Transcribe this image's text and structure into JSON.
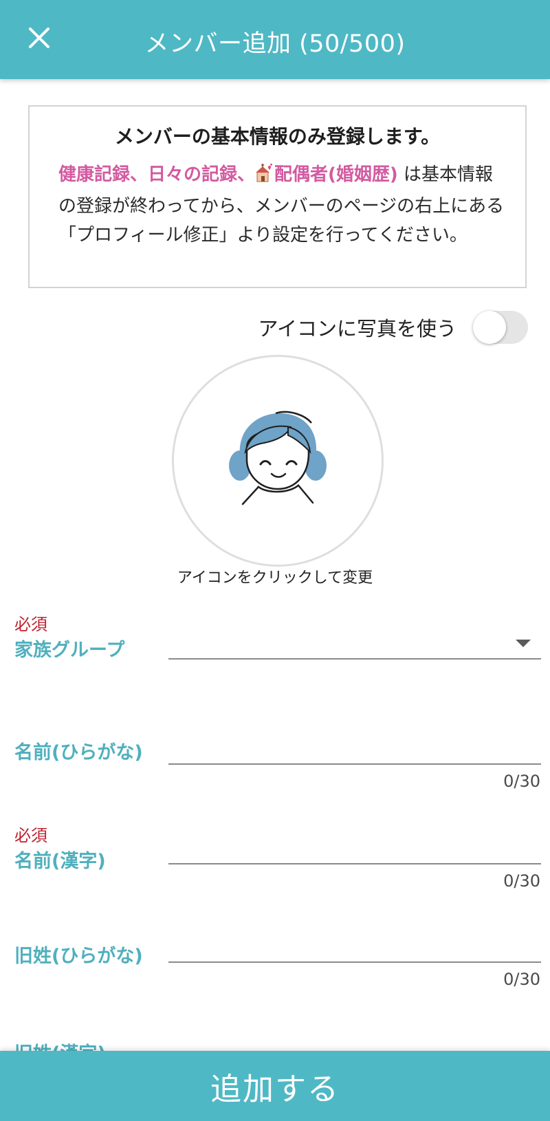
{
  "header": {
    "title": "メンバー追加 (50/500)",
    "close_icon": "close-icon"
  },
  "notice": {
    "heading": "メンバーの基本情報のみ登録します。",
    "highlight_1": "健康記録、日々の記録、",
    "highlight_2": "配偶者(婚姻歴)",
    "body": " は基本情報の登録が終わってから、メンバーのページの右上にある「プロフィール修正」より設定を行ってください。"
  },
  "photo_toggle": {
    "label": "アイコンに写真を使う",
    "on": false
  },
  "avatar": {
    "icon": "girl-avatar-icon",
    "hint": "アイコンをクリックして変更"
  },
  "form": {
    "family_group": {
      "required": "必須",
      "label": "家族グループ",
      "value": ""
    },
    "name_hiragana": {
      "label": "名前(ひらがな)",
      "value": "",
      "counter": "0/30"
    },
    "name_kanji": {
      "required": "必須",
      "label": "名前(漢字)",
      "value": "",
      "counter": "0/30"
    },
    "old_surname_hiragana": {
      "label": "旧姓(ひらがな)",
      "value": "",
      "counter": "0/30"
    },
    "old_surname_kanji": {
      "label": "旧姓(漢字)"
    }
  },
  "submit_label": "追加する",
  "colors": {
    "accent": "#4fb8c5",
    "label": "#4fb0bd",
    "required": "#c0212e",
    "highlight": "#d35aa0"
  }
}
